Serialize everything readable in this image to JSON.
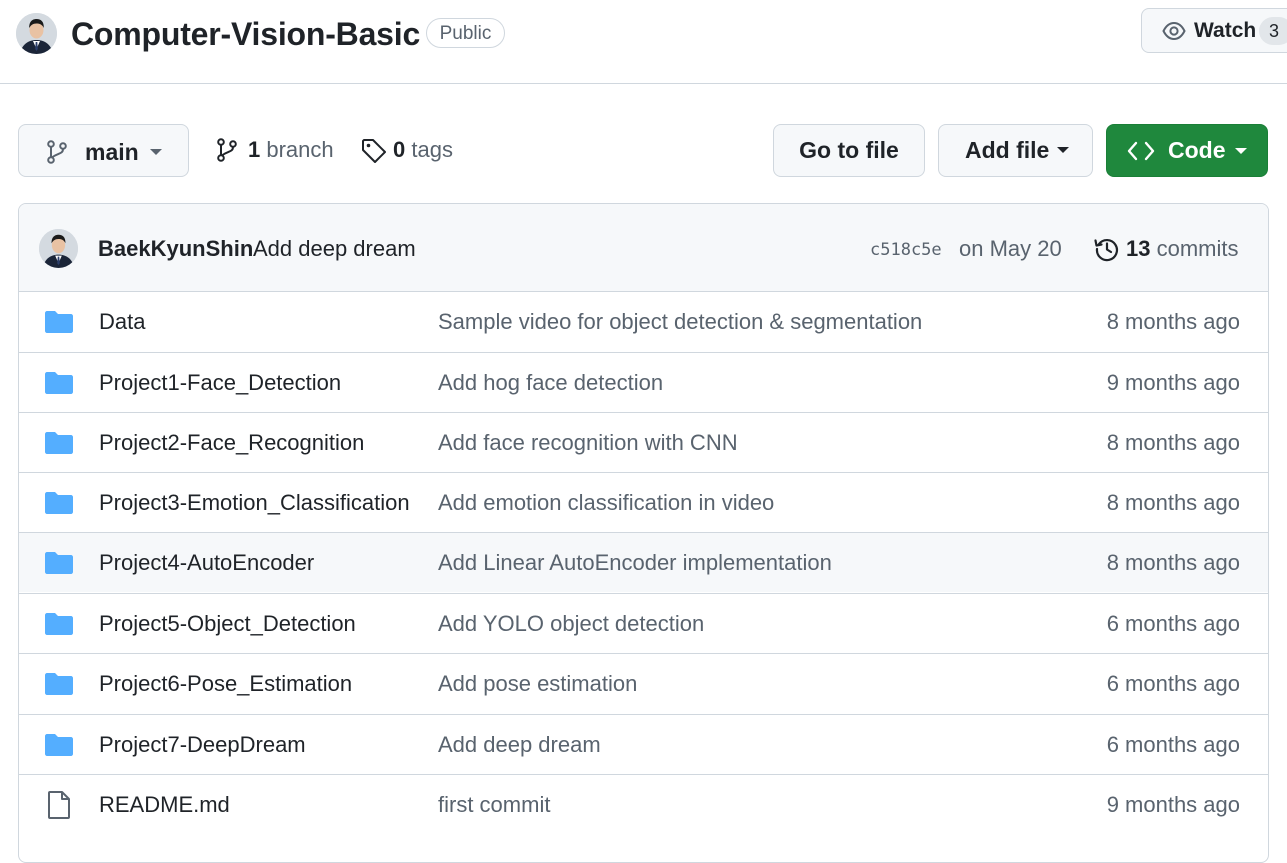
{
  "repo": {
    "name": "Computer-Vision-Basic",
    "visibility": "Public"
  },
  "watch": {
    "label": "Watch",
    "count": "3"
  },
  "toolbar": {
    "branch_name": "main",
    "branches_count": "1",
    "branches_label": "branch",
    "tags_count": "0",
    "tags_label": "tags",
    "go_to_file": "Go to file",
    "add_file": "Add file",
    "code": "Code"
  },
  "latest_commit": {
    "author": "BaekKyunShin",
    "message": "Add deep dream",
    "sha": "c518c5e",
    "date": "on May 20",
    "commits_count": "13",
    "commits_label": "commits"
  },
  "files": [
    {
      "type": "folder",
      "name": "Data",
      "message": "Sample video for object detection & segmentation",
      "age": "8 months ago"
    },
    {
      "type": "folder",
      "name": "Project1-Face_Detection",
      "message": "Add hog face detection",
      "age": "9 months ago"
    },
    {
      "type": "folder",
      "name": "Project2-Face_Recognition",
      "message": "Add face recognition with CNN",
      "age": "8 months ago"
    },
    {
      "type": "folder",
      "name": "Project3-Emotion_Classification",
      "message": "Add emotion classification in video",
      "age": "8 months ago"
    },
    {
      "type": "folder",
      "name": "Project4-AutoEncoder",
      "message": "Add Linear AutoEncoder implementation",
      "age": "8 months ago"
    },
    {
      "type": "folder",
      "name": "Project5-Object_Detection",
      "message": "Add YOLO object detection",
      "age": "6 months ago"
    },
    {
      "type": "folder",
      "name": "Project6-Pose_Estimation",
      "message": "Add pose estimation",
      "age": "6 months ago"
    },
    {
      "type": "folder",
      "name": "Project7-DeepDream",
      "message": "Add deep dream",
      "age": "6 months ago"
    },
    {
      "type": "file",
      "name": "README.md",
      "message": "first commit",
      "age": "9 months ago"
    }
  ],
  "colors": {
    "accent_green": "#1f883d",
    "folder_blue": "#54aeff",
    "muted_text": "#59636e",
    "border": "#d0d7de"
  },
  "icons": {
    "watch": "eye-icon",
    "branch": "git-branch-icon",
    "tag": "tag-icon",
    "code": "code-icon",
    "history": "history-icon",
    "folder": "folder-icon",
    "file": "file-icon"
  }
}
